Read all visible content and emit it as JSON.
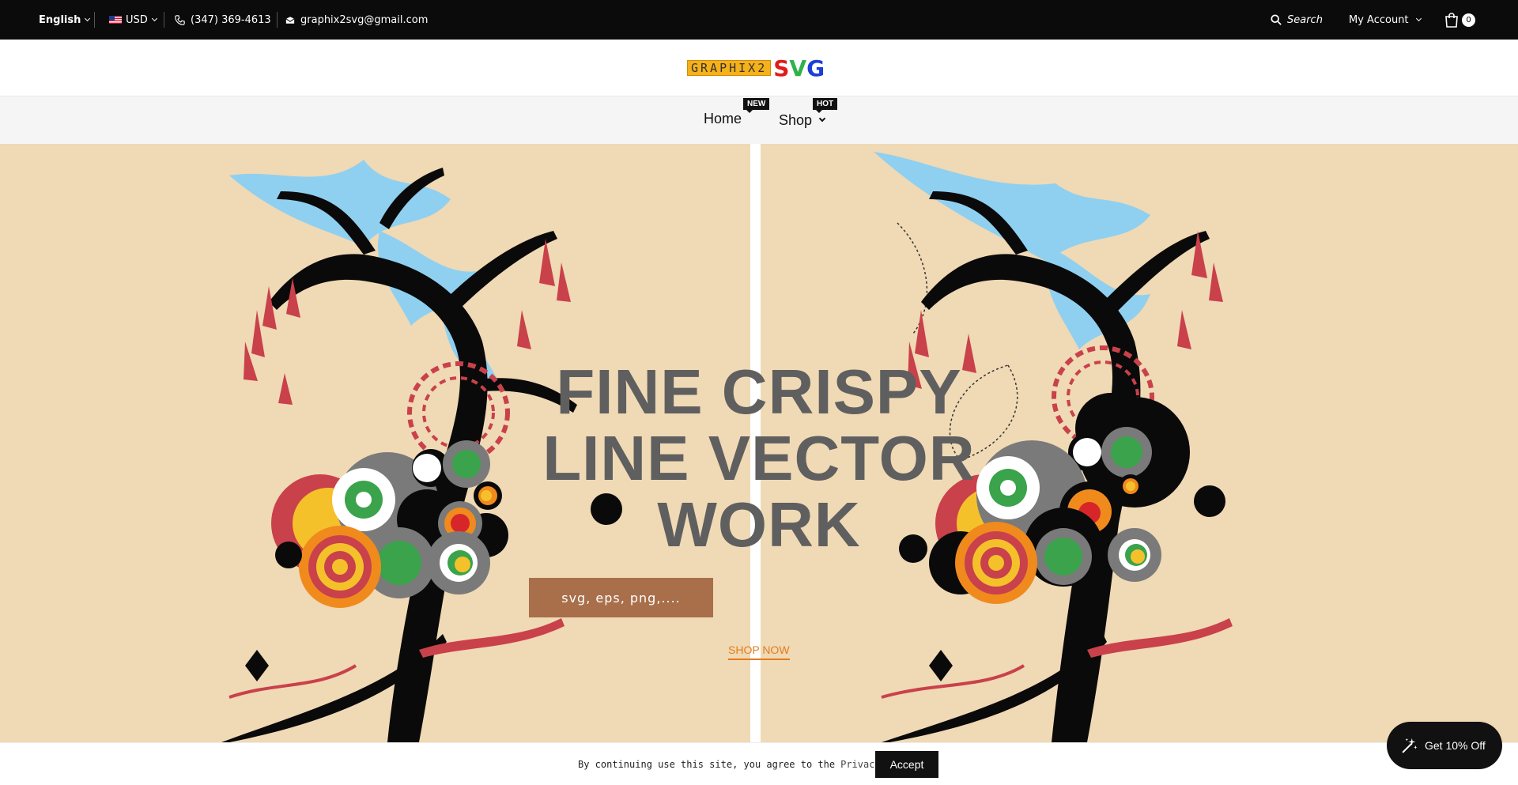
{
  "topbar": {
    "language": "English",
    "currency": "USD",
    "phone": "(347) 369-4613",
    "email": "graphix2svg@gmail.com",
    "search_label": "Search",
    "account_label": "My Account",
    "cart_count": "0"
  },
  "logo": {
    "prefix": "GRAPHIX2",
    "s": "S",
    "v": "V",
    "g": "G"
  },
  "nav": {
    "items": [
      {
        "label": "Home",
        "badge": "NEW"
      },
      {
        "label": "Shop",
        "badge": "HOT"
      }
    ]
  },
  "hero": {
    "title_line1": "FINE CRISPY",
    "title_line2": "LINE VECTOR",
    "title_line3": "WORK",
    "formats_button": "svg, eps, png,....",
    "cta": "SHOP NOW"
  },
  "cookie": {
    "text": "By continuing use this site, you agree to the",
    "link": "Privacy Policy",
    "accept": "Accept"
  },
  "discount": {
    "label": "Get 10% Off"
  },
  "colors": {
    "topbar_bg": "#0b0b0b",
    "hero_bg": "#f0d9b5",
    "hero_title": "#5f5f5f",
    "button_brown": "#a86f4a",
    "cta_orange": "#e27d1d"
  }
}
